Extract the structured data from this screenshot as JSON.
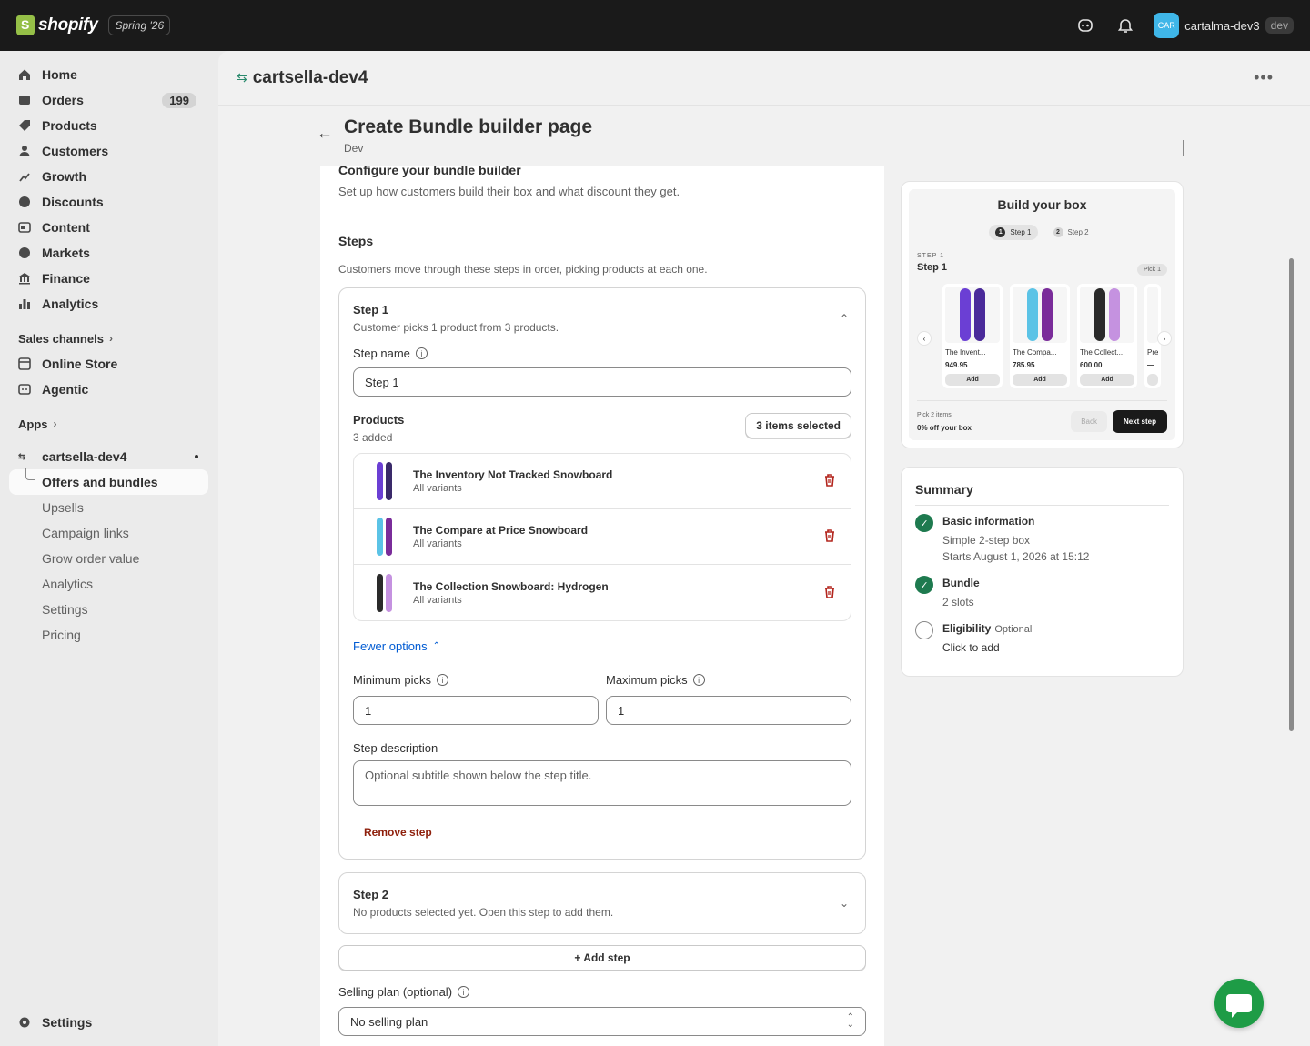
{
  "topbar": {
    "brand": "shopify",
    "edition": "Spring '26",
    "store_avatar": "CAR",
    "store_name": "cartalma-dev3",
    "store_tag": "dev"
  },
  "sidebar": {
    "items": [
      {
        "label": "Home",
        "icon": "home-icon"
      },
      {
        "label": "Orders",
        "icon": "orders-icon",
        "count": "199"
      },
      {
        "label": "Products",
        "icon": "tag-icon"
      },
      {
        "label": "Customers",
        "icon": "person-icon"
      },
      {
        "label": "Growth",
        "icon": "growth-icon"
      },
      {
        "label": "Discounts",
        "icon": "discount-icon"
      },
      {
        "label": "Content",
        "icon": "content-icon"
      },
      {
        "label": "Markets",
        "icon": "globe-icon"
      },
      {
        "label": "Finance",
        "icon": "bank-icon"
      },
      {
        "label": "Analytics",
        "icon": "chart-icon"
      }
    ],
    "sales_channels": "Sales channels",
    "channels": [
      {
        "label": "Online Store"
      },
      {
        "label": "Agentic"
      }
    ],
    "apps": "Apps",
    "app_name": "cartsella-dev4",
    "app_sub": [
      "Offers and bundles",
      "Upsells",
      "Campaign links",
      "Grow order value",
      "Analytics",
      "Settings",
      "Pricing"
    ],
    "settings": "Settings"
  },
  "main": {
    "app_title": "cartsella-dev4",
    "page_title": "Create Bundle builder page",
    "page_sub": "Dev",
    "config_title": "Configure your bundle builder",
    "config_desc": "Set up how customers build their box and what discount they get.",
    "steps_title": "Steps",
    "steps_desc": "Customers move through these steps in order, picking products at each one.",
    "step1": {
      "title": "Step 1",
      "sub": "Customer picks 1 product from 3 products.",
      "name_label": "Step name",
      "name_value": "Step 1",
      "products_label": "Products",
      "products_added": "3 added",
      "selected_btn": "3 items selected",
      "products": [
        {
          "name": "The Inventory Not Tracked Snowboard",
          "variant": "All variants"
        },
        {
          "name": "The Compare at Price Snowboard",
          "variant": "All variants"
        },
        {
          "name": "The Collection Snowboard: Hydrogen",
          "variant": "All variants"
        }
      ],
      "fewer_options": "Fewer options",
      "min_label": "Minimum picks",
      "min_value": "1",
      "max_label": "Maximum picks",
      "max_value": "1",
      "desc_label": "Step description",
      "desc_placeholder": "Optional subtitle shown below the step title.",
      "remove": "Remove step"
    },
    "step2": {
      "title": "Step 2",
      "sub": "No products selected yet. Open this step to add them."
    },
    "add_step": "+ Add step",
    "selling_label": "Selling plan (optional)",
    "selling_value": "No selling plan"
  },
  "preview": {
    "title": "Build your box",
    "tab1": "Step 1",
    "tab1_num": "1",
    "tab2": "Step 2",
    "tab2_num": "2",
    "step_label": "STEP 1",
    "step_name": "Step 1",
    "pick": "Pick 1",
    "cards": [
      {
        "name": "The Invent...",
        "price": "949.95",
        "add": "Add"
      },
      {
        "name": "The Compa...",
        "price": "785.95",
        "add": "Add"
      },
      {
        "name": "The Collect...",
        "price": "600.00",
        "add": "Add"
      }
    ],
    "partial_name": "Prev",
    "partial_price": "—",
    "footer_line1": "Pick 2 items",
    "footer_line2": "0% off your box",
    "back": "Back",
    "next": "Next step"
  },
  "summary": {
    "title": "Summary",
    "items": [
      {
        "title": "Basic information",
        "lines": [
          "Simple 2-step box",
          "Starts August 1, 2026 at 15:12"
        ]
      },
      {
        "title": "Bundle",
        "lines": [
          "2 slots"
        ]
      },
      {
        "title": "Eligibility",
        "optional": "Optional",
        "lines": [
          "Click to add"
        ]
      }
    ]
  },
  "colors": {
    "accent_green": "#1e7a4f",
    "link_blue": "#005bd3",
    "danger": "#b3261e",
    "chat": "#1e9c46"
  }
}
